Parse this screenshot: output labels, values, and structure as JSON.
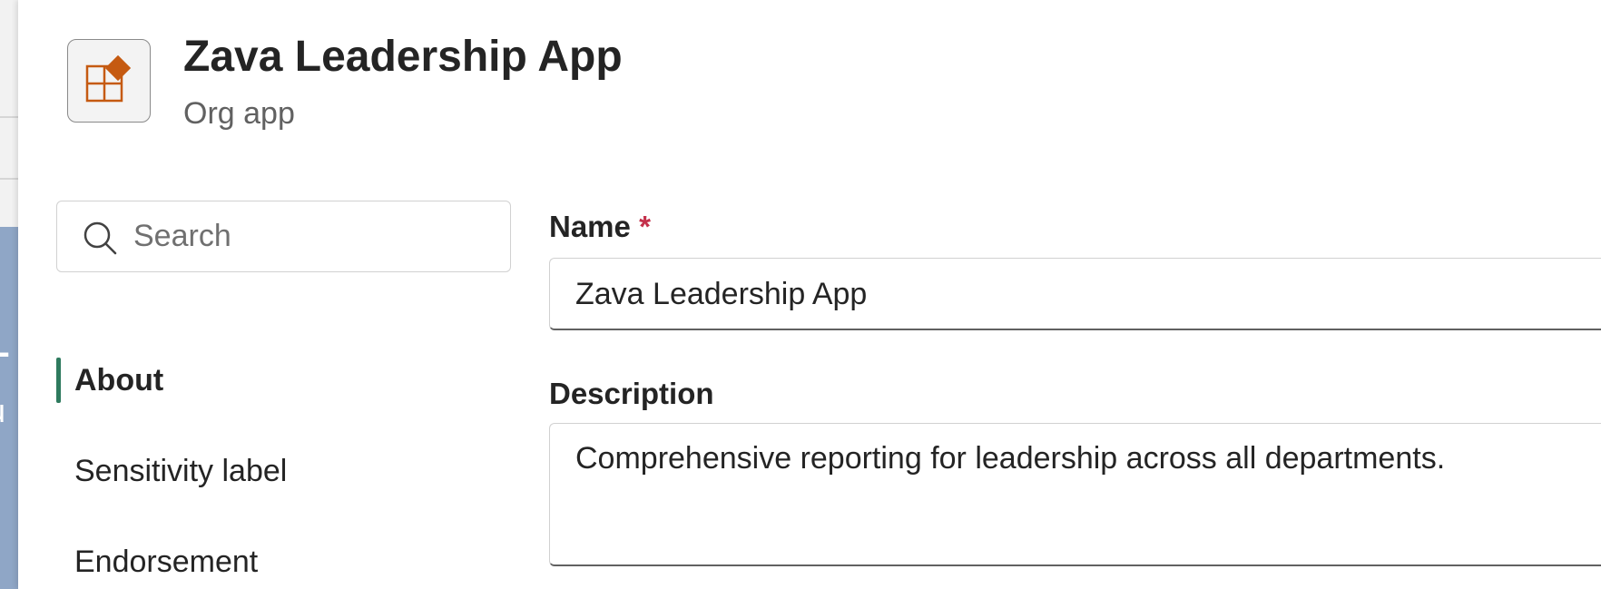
{
  "header": {
    "app_name": "Zava Leadership App",
    "app_type": "Org app",
    "icon": "org-app-icon",
    "icon_color": "#c55a11"
  },
  "search": {
    "placeholder": "Search",
    "value": ""
  },
  "nav": {
    "items": [
      {
        "label": "About",
        "active": true
      },
      {
        "label": "Sensitivity label",
        "active": false
      },
      {
        "label": "Endorsement",
        "active": false
      }
    ],
    "indicator_color": "#2e7a5e"
  },
  "form": {
    "name": {
      "label": "Name",
      "required_marker": "*",
      "value": "Zava Leadership App"
    },
    "description": {
      "label": "Description",
      "value": "Comprehensive reporting for leadership across all departments."
    }
  },
  "background": {
    "glyphs": [
      "L",
      "u"
    ]
  }
}
